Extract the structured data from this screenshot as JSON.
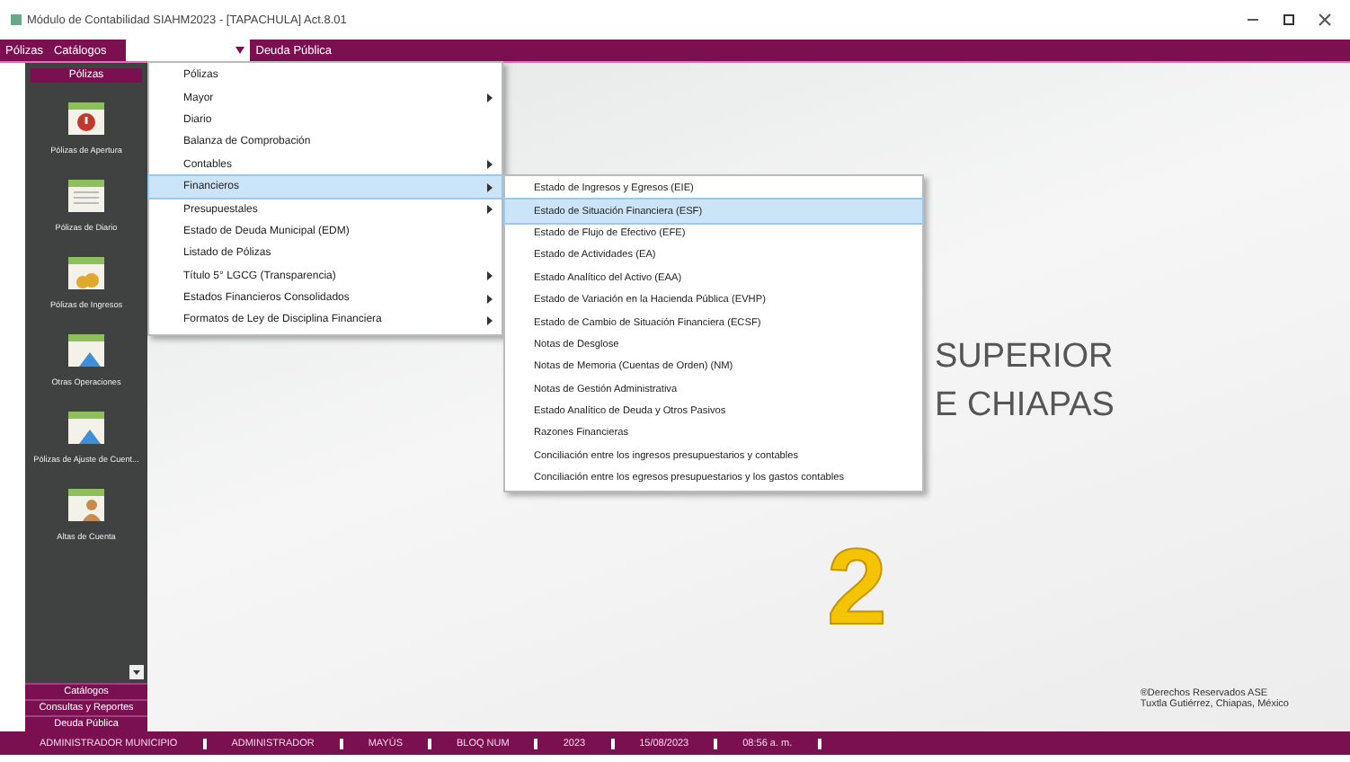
{
  "window": {
    "title": "Módulo de Contabilidad SIAHM2023 - [TAPACHULA] Act.8.01"
  },
  "menubar": [
    {
      "label": "Pólizas",
      "kind": "item",
      "selected": false
    },
    {
      "label": "Catálogos",
      "kind": "item",
      "selected": false
    },
    {
      "kind": "open",
      "selected": true
    },
    {
      "label": "Deuda Pública",
      "kind": "item",
      "selected": false
    }
  ],
  "sidebar": {
    "header": "Pólizas",
    "items": [
      {
        "label": "Pólizas de Apertura",
        "kind": "alert"
      },
      {
        "label": "Pólizas de Diario",
        "kind": "sheet"
      },
      {
        "label": "Pólizas de Ingresos",
        "kind": "coins"
      },
      {
        "label": "Otras Operaciones",
        "kind": "sheet-blue"
      },
      {
        "label": "Pólizas de Ajuste de Cuent...",
        "kind": "sheet-blue"
      },
      {
        "label": "Altas de Cuenta",
        "kind": "person"
      }
    ],
    "sections": [
      "Catálogos",
      "Consultas y Reportes",
      "Deuda Pública"
    ]
  },
  "menu": {
    "items": [
      {
        "label": "Pólizas",
        "submenu": false,
        "selected": false
      },
      {
        "label": "Mayor",
        "submenu": true,
        "selected": false
      },
      {
        "label": "Diario",
        "submenu": false,
        "selected": false
      },
      {
        "label": "Balanza de Comprobación",
        "submenu": false,
        "selected": false
      },
      {
        "label": "Contables",
        "submenu": true,
        "selected": false
      },
      {
        "label": "Financieros",
        "submenu": true,
        "selected": true
      },
      {
        "label": "Presupuestales",
        "submenu": true,
        "selected": false
      },
      {
        "label": "Estado de Deuda Municipal (EDM)",
        "submenu": false,
        "selected": false
      },
      {
        "label": "Listado de Pólizas",
        "submenu": false,
        "selected": false
      },
      {
        "label": "Título 5° LGCG (Transparencia)",
        "submenu": true,
        "selected": false
      },
      {
        "label": "Estados Financieros Consolidados",
        "submenu": true,
        "selected": false
      },
      {
        "label": "Formatos de Ley de Disciplina Financiera",
        "submenu": true,
        "selected": false
      }
    ]
  },
  "submenu": {
    "items": [
      {
        "label": "Estado de Ingresos y Egresos (EIE)",
        "selected": false
      },
      {
        "label": "Estado de Situación Financiera (ESF)",
        "selected": true
      },
      {
        "label": "Estado de Flujo de Efectivo (EFE)",
        "selected": false
      },
      {
        "label": "Estado de Actividades (EA)",
        "selected": false
      },
      {
        "label": "Estado Analítico del Activo (EAA)",
        "selected": false
      },
      {
        "label": "Estado de Variación en la Hacienda Pública (EVHP)",
        "selected": false
      },
      {
        "label": "Estado de Cambio de Situación Financiera (ECSF)",
        "selected": false
      },
      {
        "label": "Notas de Desglose",
        "selected": false
      },
      {
        "label": "Notas de Memoria (Cuentas de Orden) (NM)",
        "selected": false
      },
      {
        "label": "Notas de Gestión Administrativa",
        "selected": false
      },
      {
        "label": "Estado Analítico de Deuda y Otros Pasivos",
        "selected": false
      },
      {
        "label": "Razones Financieras",
        "selected": false
      },
      {
        "label": "Conciliación entre los ingresos presupuestarios y contables",
        "selected": false
      },
      {
        "label": "Conciliación entre los egresos presupuestarios y los gastos contables",
        "selected": false
      }
    ]
  },
  "background": {
    "lines": [
      "SUPERIOR",
      "E CHIAPAS"
    ],
    "copyright": [
      "®Derechos Reservados ASE",
      "Tuxtla Gutiérrez, Chiapas, México"
    ]
  },
  "annotation": "2",
  "status_bar": [
    "ADMINISTRADOR MUNICIPIO",
    "ADMINISTRADOR",
    "MAYÚS",
    "BLOQ NUM",
    "2023",
    "15/08/2023",
    "08:56 a. m."
  ]
}
